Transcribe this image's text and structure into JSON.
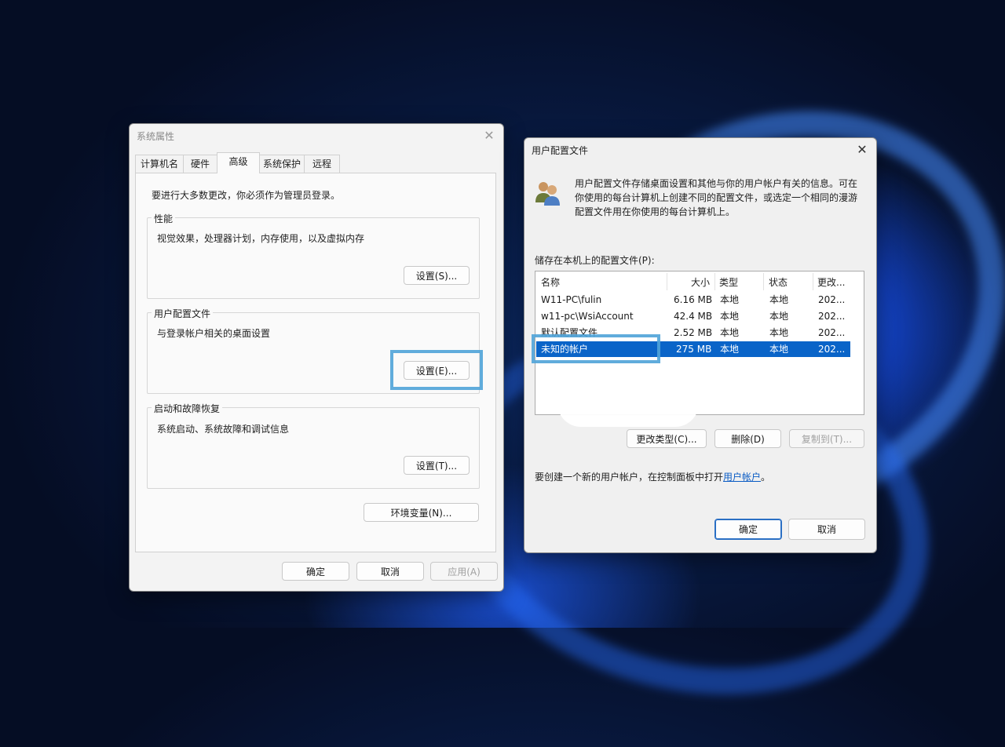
{
  "system_properties": {
    "title": "系统属性",
    "tabs": [
      "计算机名",
      "硬件",
      "高级",
      "系统保护",
      "远程"
    ],
    "admin_note": "要进行大多数更改，你必须作为管理员登录。",
    "performance": {
      "title": "性能",
      "desc": "视觉效果，处理器计划，内存使用，以及虚拟内存",
      "button": "设置(S)..."
    },
    "user_profiles": {
      "title": "用户配置文件",
      "desc": "与登录帐户相关的桌面设置",
      "button": "设置(E)..."
    },
    "startup": {
      "title": "启动和故障恢复",
      "desc": "系统启动、系统故障和调试信息",
      "button": "设置(T)..."
    },
    "env_button": "环境变量(N)...",
    "ok": "确定",
    "cancel": "取消",
    "apply": "应用(A)"
  },
  "user_profile_dialog": {
    "title": "用户配置文件",
    "description_lines": [
      "用户配置文件存储桌面设置和其他与你的用户帐户有关的信息。可在",
      "你使用的每台计算机上创建不同的配置文件，或选定一个相同的漫游",
      "配置文件用在你使用的每台计算机上。"
    ],
    "list_label": "储存在本机上的配置文件(P):",
    "columns": [
      "名称",
      "大小",
      "类型",
      "状态",
      "更改..."
    ],
    "rows": [
      {
        "name": "W11-PC\\fulin",
        "size": "6.16 MB",
        "type": "本地",
        "status": "本地",
        "modified": "202..."
      },
      {
        "name": "w11-pc\\WsiAccount",
        "size": "42.4 MB",
        "type": "本地",
        "status": "本地",
        "modified": "202..."
      },
      {
        "name": "默认配置文件",
        "size": "2.52 MB",
        "type": "本地",
        "status": "本地",
        "modified": "202..."
      },
      {
        "name": "未知的帐户",
        "size": "275 MB",
        "type": "本地",
        "status": "本地",
        "modified": "202..."
      }
    ],
    "selected_row": 3,
    "change_type_button": "更改类型(C)...",
    "delete_button": "删除(D)",
    "copy_button": "复制到(T)...",
    "footer_text": "要创建一个新的用户帐户，在控制面板中打开",
    "footer_link": "用户帐户",
    "footer_end": "。",
    "ok": "确定",
    "cancel": "取消"
  },
  "colors": {
    "selection": "#0a64c8",
    "highlight_box": "#4fa3d8",
    "link": "#0a5bc4"
  }
}
